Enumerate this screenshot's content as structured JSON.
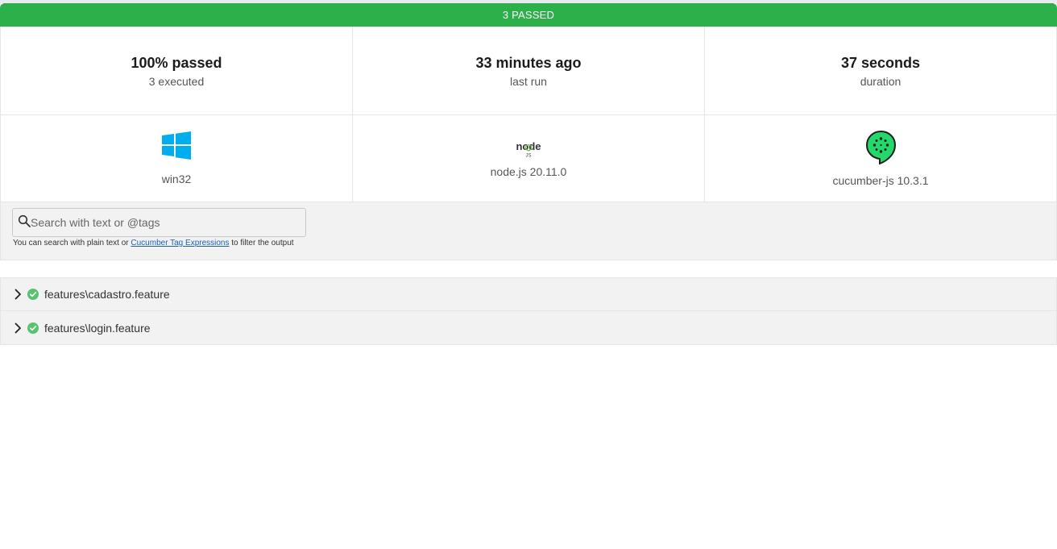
{
  "status": {
    "text": "3 PASSED",
    "color": "#2cb14a"
  },
  "stats": [
    {
      "value": "100% passed",
      "label": "3 executed"
    },
    {
      "value": "33 minutes ago",
      "label": "last run"
    },
    {
      "value": "37 seconds",
      "label": "duration"
    }
  ],
  "environment": [
    {
      "icon": "windows-icon",
      "label": "win32"
    },
    {
      "icon": "nodejs-icon",
      "label": "node.js 20.11.0"
    },
    {
      "icon": "cucumber-icon",
      "label": "cucumber-js 10.3.1"
    }
  ],
  "search": {
    "placeholder": "Search with text or @tags",
    "help_prefix": "You can search with plain text or ",
    "help_link": "Cucumber Tag Expressions",
    "help_suffix": " to filter the output"
  },
  "features": [
    {
      "name": "features\\cadastro.feature",
      "status": "passed"
    },
    {
      "name": "features\\login.feature",
      "status": "passed"
    }
  ]
}
